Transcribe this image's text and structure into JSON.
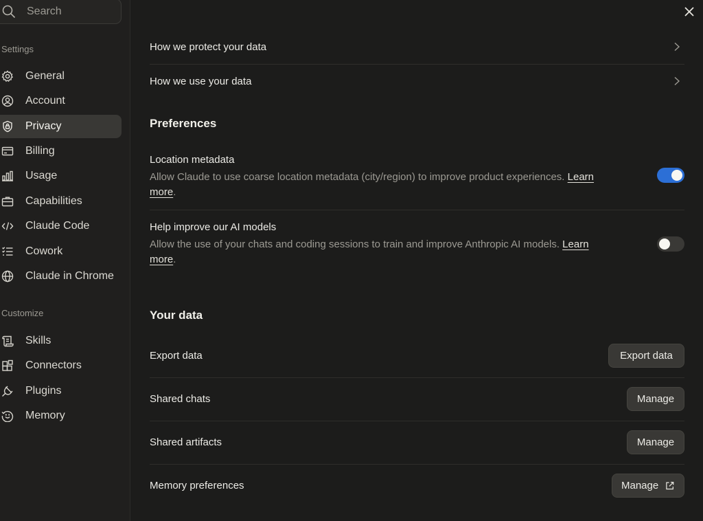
{
  "search": {
    "placeholder": "Search"
  },
  "sidebar": {
    "settings_label": "Settings",
    "settings_items": [
      {
        "label": "General",
        "icon": "gear-icon"
      },
      {
        "label": "Account",
        "icon": "user-circle-icon"
      },
      {
        "label": "Privacy",
        "icon": "shield-lock-icon",
        "active": true
      },
      {
        "label": "Billing",
        "icon": "credit-card-icon"
      },
      {
        "label": "Usage",
        "icon": "bar-chart-icon"
      },
      {
        "label": "Capabilities",
        "icon": "briefcase-icon"
      },
      {
        "label": "Claude Code",
        "icon": "code-icon"
      },
      {
        "label": "Cowork",
        "icon": "checklist-icon"
      },
      {
        "label": "Claude in Chrome",
        "icon": "globe-icon"
      }
    ],
    "customize_label": "Customize",
    "customize_items": [
      {
        "label": "Skills",
        "icon": "scroll-icon"
      },
      {
        "label": "Connectors",
        "icon": "blocks-icon"
      },
      {
        "label": "Plugins",
        "icon": "plug-icon"
      },
      {
        "label": "Memory",
        "icon": "memory-icon"
      }
    ]
  },
  "main": {
    "links": [
      {
        "label": "How we protect your data"
      },
      {
        "label": "How we use your data"
      }
    ],
    "preferences_heading": "Preferences",
    "preferences": [
      {
        "title": "Location metadata",
        "description": "Allow Claude to use coarse location metadata (city/region) to improve product experiences.",
        "learn_more_1": "Learn",
        "learn_more_2": "more",
        "enabled": true
      },
      {
        "title": "Help improve our AI models",
        "description": "Allow the use of your chats and coding sessions to train and improve Anthropic AI models.",
        "learn_more_1": "Learn",
        "learn_more_2": "more",
        "enabled": false
      }
    ],
    "your_data_heading": "Your data",
    "data_rows": [
      {
        "label": "Export data",
        "button": "Export data"
      },
      {
        "label": "Shared chats",
        "button": "Manage"
      },
      {
        "label": "Shared artifacts",
        "button": "Manage"
      },
      {
        "label": "Memory preferences",
        "button": "Manage",
        "button_icon": "external-link-icon"
      }
    ]
  },
  "colors": {
    "accent": "#2c6fd6",
    "background": "#1c1c1b",
    "sidebar": "#201f1e"
  }
}
